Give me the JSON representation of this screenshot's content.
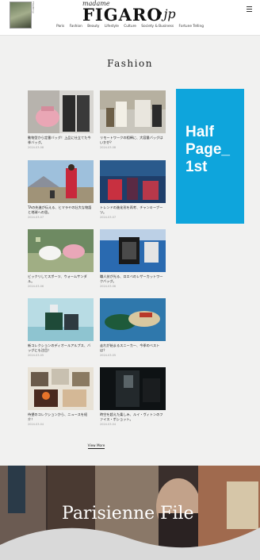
{
  "header": {
    "logo_small": "madame",
    "logo_main": "FIGARO",
    "logo_suffix": "•jp",
    "side_text": "FIGARO.jp",
    "nav": [
      "Paris",
      "Fashion",
      "Beauty",
      "Lifestyle",
      "Culture",
      "Society & Business",
      "Fortune Telling"
    ]
  },
  "section": {
    "title": "Fashion",
    "view_more": "View More"
  },
  "articles": [
    {
      "caption": "動物型から定番バッグ！上品に仕立てた今季バッグ。",
      "date": "2024.03.08"
    },
    {
      "caption": "リモートワークの相棒に、大容量バッグはいかが？",
      "date": "2024.03.08"
    },
    {
      "caption": "TAの先進が伝える、ヒマラヤの壮大な物語と地球への思。",
      "date": "2024.03.07"
    },
    {
      "caption": "トレンドの進化形を再考、チャンキーブーツ。",
      "date": "2024.03.07"
    },
    {
      "caption": "ビックリしてスポーツ、ウォームサンダル。",
      "date": "2024.03.06"
    },
    {
      "caption": "職人技が光る、ロエベのレザーカットワークバッグ。",
      "date": "2024.03.06"
    },
    {
      "caption": "新コレクションのディオールアルプス、バッグにも注目！",
      "date": "2024.03.05"
    },
    {
      "caption": "走れが始まるスニーカー、今季のベストは？",
      "date": "2024.03.05"
    },
    {
      "caption": "待望のコレクションから、ニュースを紹介！",
      "date": "2024.03.04"
    },
    {
      "caption": "時空を超えた楽しみ、ルイ・ヴィトンのファイス・ポショット。",
      "date": "2024.03.04"
    }
  ],
  "ad": {
    "label": "Half\nPage_\n1st"
  },
  "banner": {
    "title": "Parisienne File"
  }
}
